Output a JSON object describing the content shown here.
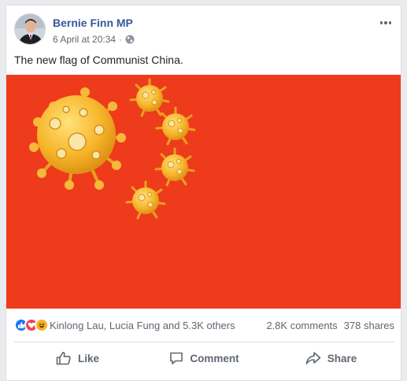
{
  "post": {
    "author": "Bernie Finn MP",
    "timestamp": "6 April at 20:34",
    "separator": "·",
    "audience_icon": "globe-icon",
    "text": "The new flag of Communist China.",
    "image_background": "#ee3b1c"
  },
  "reactions": {
    "icons": [
      "like-reaction-icon",
      "love-reaction-icon",
      "haha-reaction-icon"
    ],
    "summary": "Kinlong Lau, Lucia Fung and 5.3K others",
    "comments": "2.8K comments",
    "shares": "378 shares"
  },
  "actions": {
    "like": "Like",
    "comment": "Comment",
    "share": "Share"
  },
  "colors": {
    "author_link": "#365899",
    "like_blue": "#1877f2",
    "love_red": "#f33e58",
    "haha_yellow": "#f7b125"
  }
}
